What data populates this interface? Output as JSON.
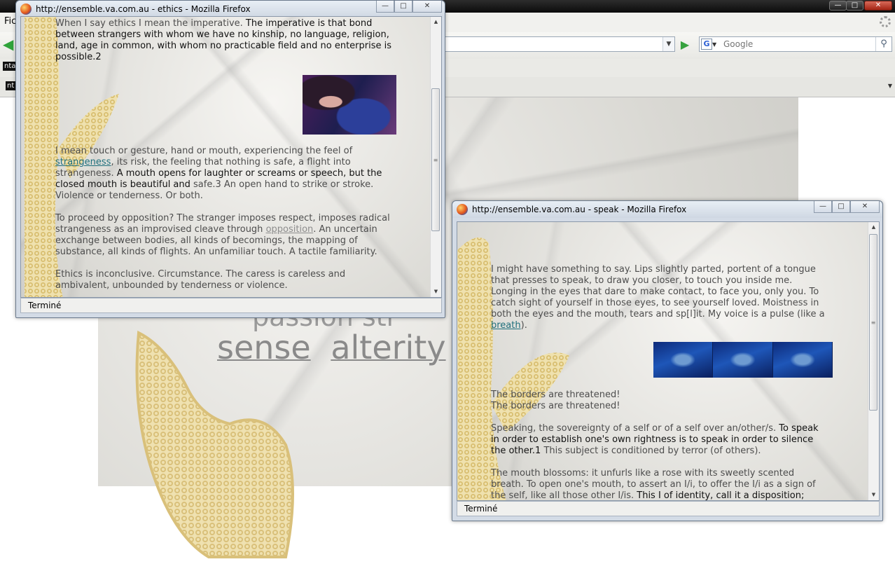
{
  "main_window": {
    "menu_first": "Fic",
    "search_placeholder": "Google",
    "tab_label_1": "nta",
    "tab_label_2": "nt",
    "background_words": [
      "sense",
      "alterity"
    ],
    "background_partial_words": "passion str"
  },
  "ethics_popup": {
    "title": "http://ensemble.va.com.au - ethics - Mozilla Firefox",
    "status": "Terminé",
    "paragraphs": [
      {
        "t1": "When I say ethics I mean the imperative.",
        "t2": " The imperative is that bond between strangers with whom we have no kinship, no language, religion, land, age in common, with whom no practicable field and no enterprise is possible.2"
      },
      {
        "t1": "I mean touch or gesture, hand or mouth, experiencing the feel of ",
        "link": "strangeness",
        "t2": ", its risk, the feeling that nothing is safe, a flight into strangeness.",
        "t3": " A mouth opens for laughter or screams or speech, but the closed mouth is beautiful and",
        "t4": " safe.3 An open hand to strike or stroke. Violence or tenderness. Or both."
      },
      {
        "t1": "To proceed by opposition? The stranger imposes respect, imposes radical strangeness as an improvised cleave through ",
        "link": "opposition",
        "t2": ". An uncertain exchange between bodies, all kinds of becomings, the mapping of substance, all kinds of flights. An unfamiliar touch. A tactile familiarity."
      },
      {
        "t1": "Ethics is inconclusive. Circumstance. The caress is careless and ambivalent, unbounded by tenderness or violence."
      }
    ]
  },
  "speak_popup": {
    "title": "http://ensemble.va.com.au - speak - Mozilla Firefox",
    "status": "Terminé",
    "paragraphs": [
      {
        "t1": "I might have something to say. Lips slightly parted, portent of a tongue that presses to speak, to draw you closer, to touch you inside me. Longing in the eyes that dare to make contact, to face you, only you. To catch sight of yourself in those eyes, to see yourself loved. Moistness in both the eyes and the mouth, tears and sp[l]it. My voice is a pulse (like a ",
        "link": "breath",
        "t2": ")."
      },
      {
        "line1": "The borders are threatened!",
        "line2": "The borders are threatened!"
      },
      {
        "t1": "Speaking, the sovereignty of a self or of a self over an/other/s.",
        "t2": " To speak in order to establish one's own rightness is to speak in order to silence the other.1",
        "t3": " This subject is conditioned by terror (of others)."
      },
      {
        "t1": "The mouth blossoms: it unfurls like a rose with its sweetly scented breath. To open one's mouth, to assert an I/i, to offer the I/i as a sign of the self, like all those other I/is.",
        "t2": " This I of identity, call it a disposition;"
      }
    ]
  },
  "colors": {
    "link": "#1f6f7c",
    "visited_link": "#8d8d8d",
    "hand_fill": "#e9d9a0"
  }
}
